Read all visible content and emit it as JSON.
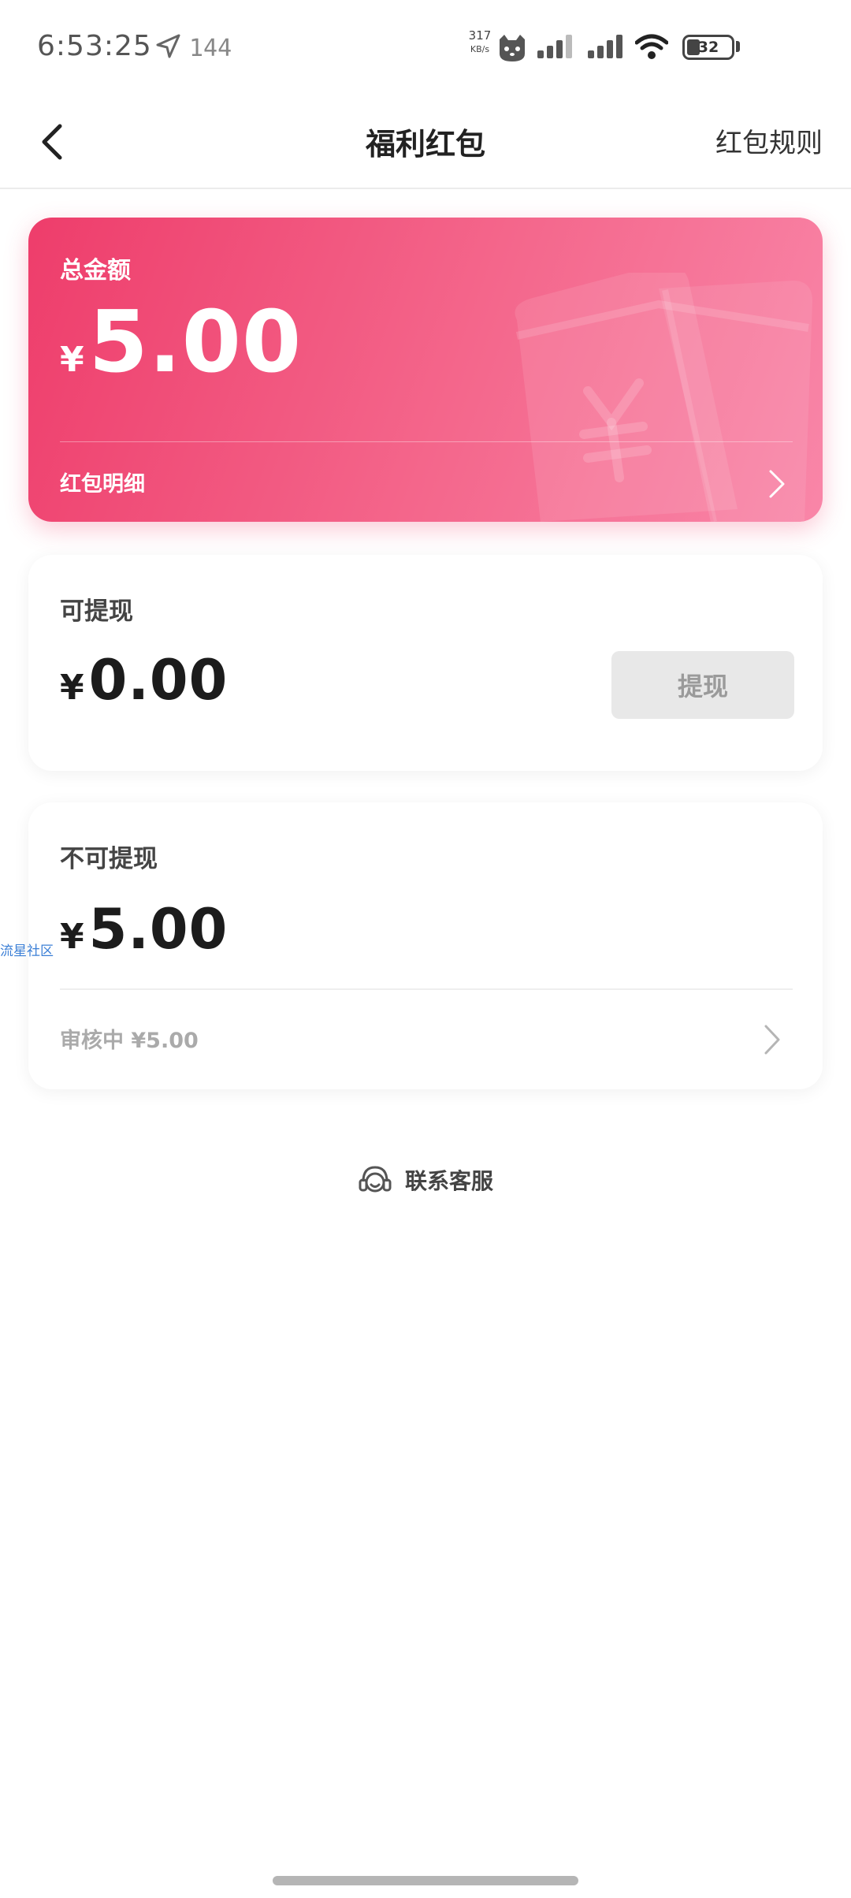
{
  "status_bar": {
    "time": "6:53:25",
    "refresh_rate": "144",
    "net_speed_value": "317",
    "net_speed_unit": "KB/s",
    "battery_level": "32"
  },
  "nav": {
    "title": "福利红包",
    "rules_label": "红包规则"
  },
  "total_card": {
    "label": "总金额",
    "currency": "¥",
    "amount": "5.00",
    "detail_label": "红包明细"
  },
  "withdrawable": {
    "label": "可提现",
    "currency": "¥",
    "amount": "0.00",
    "button_label": "提现"
  },
  "non_withdrawable": {
    "label": "不可提现",
    "currency": "¥",
    "amount": "5.00",
    "review_text": "审核中 ¥5.00"
  },
  "watermark": "流星社区",
  "contact": {
    "label": "联系客服"
  },
  "colors": {
    "card_gradient_start": "#ee3d6b",
    "card_gradient_end": "#f986a8",
    "disabled_button": "#e8e8e8"
  }
}
